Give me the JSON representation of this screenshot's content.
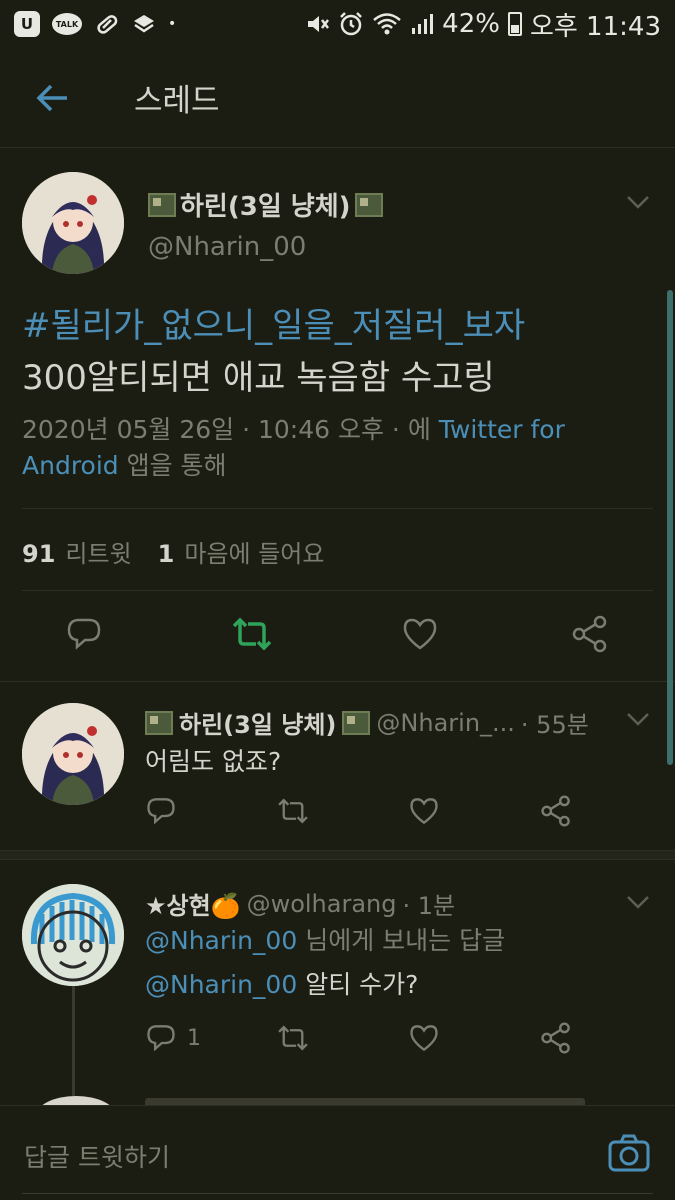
{
  "status_bar": {
    "talk_label": "TALK",
    "u_label": "U",
    "dot": "•",
    "battery": "42%",
    "time": "오후 11:43"
  },
  "header": {
    "title": "스레드"
  },
  "main_tweet": {
    "name": "하린(3일 냥체)",
    "handle": "@Nharin_00",
    "hashtag": "#될리가_없으니_일을_저질러_보자",
    "text": "300알티되면 애교 녹음함 수고링",
    "meta_prefix": "2020년 05월 26일 · 10:46 오후 · 에 ",
    "meta_link": "Twitter for Android",
    "meta_suffix": " 앱을 통해",
    "retweet_count": "91",
    "retweet_label": "리트윗",
    "like_count": "1",
    "like_label": "마음에 들어요"
  },
  "replies": [
    {
      "name": "하린(3일 냥체)",
      "handle": "@Nharin_...",
      "time": "· 55분",
      "text": "어림도 없죠?"
    },
    {
      "name": "★상현🍊",
      "handle": "@wolharang",
      "time": "· 1분",
      "reply_to_handle": "@Nharin_00",
      "reply_to_suffix": " 님에게 보내는 답글",
      "mention": "@Nharin_00",
      "text": " 알티 수가?",
      "reply_count": "1"
    }
  ],
  "composer": {
    "placeholder": "답글 트윗하기"
  },
  "colors": {
    "background": "#1c1d12",
    "link": "#4b8fb8",
    "retweet_active": "#2fa35a",
    "muted": "#7b7d70"
  }
}
